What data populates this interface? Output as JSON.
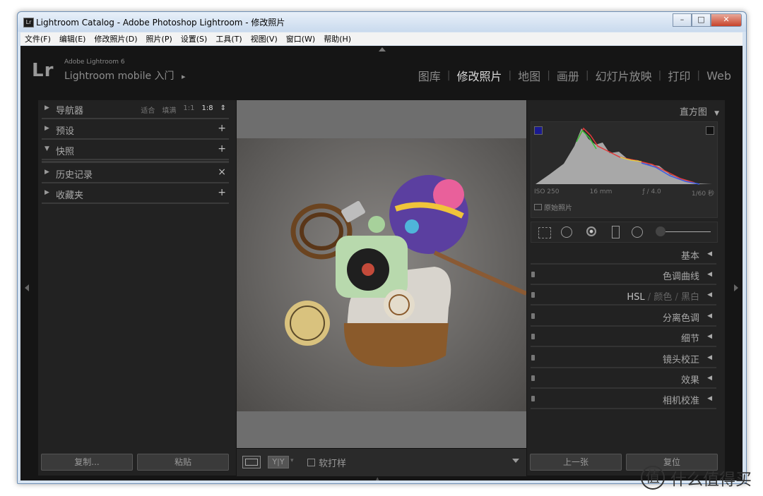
{
  "window": {
    "title": "Lightroom Catalog - Adobe Photoshop Lightroom - 修改照片",
    "icon_text": "Lr",
    "minimize": "–",
    "maximize": "□",
    "close": "✕"
  },
  "menu": [
    "文件(F)",
    "编辑(E)",
    "修改照片(D)",
    "照片(P)",
    "设置(S)",
    "工具(T)",
    "视图(V)",
    "窗口(W)",
    "帮助(H)"
  ],
  "brand": {
    "logo": "Lr",
    "line1": "Adobe Lightroom 6",
    "line2": "Lightroom mobile 入门",
    "arrow": "▸"
  },
  "modules": [
    "图库",
    "修改照片",
    "地图",
    "画册",
    "幻灯片放映",
    "打印",
    "Web"
  ],
  "active_module": "修改照片",
  "left_panel": {
    "navigator": {
      "label": "导航器",
      "zoom": [
        "适合",
        "填满",
        "1:1",
        "1:8"
      ],
      "zoom_selected": "1:8",
      "zoom_arrow": "⇕"
    },
    "presets": {
      "label": "预设",
      "action": "+"
    },
    "snapshots": {
      "label": "快照",
      "action": "+"
    },
    "history": {
      "label": "历史记录",
      "action": "×"
    },
    "collections": {
      "label": "收藏夹",
      "action": "+"
    },
    "copy_button": "复制...",
    "paste_button": "粘贴"
  },
  "toolbar": {
    "soft_proof_label": "软打样",
    "yy_label": "Y|Y"
  },
  "right_panel": {
    "histogram_label": "直方图",
    "exif": {
      "iso": "ISO 250",
      "focal": "16 mm",
      "aperture": "ƒ / 4.0",
      "shutter": "1/60 秒"
    },
    "original_photo_label": "原始照片",
    "sections": [
      "基本",
      "色调曲线",
      "HSL / 颜色 / 黑白",
      "分离色调",
      "细节",
      "镜头校正",
      "效果",
      "相机校准"
    ],
    "hsl_parts": [
      "HSL",
      "颜色",
      "黑白"
    ],
    "prev_button": "上一张",
    "reset_button": "复位"
  },
  "watermark": {
    "icon": "值",
    "text": "什么值得买"
  },
  "colors": {
    "app_bg": "#151515",
    "panel_bg": "#222222",
    "text": "#a8a8a8",
    "active_text": "#d8d8d8"
  }
}
